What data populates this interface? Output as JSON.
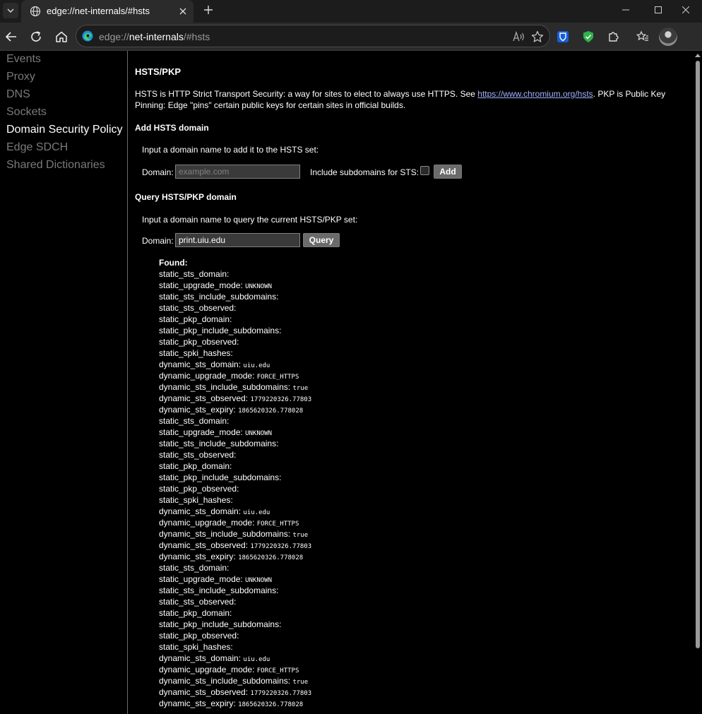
{
  "tab": {
    "title": "edge://net-internals/#hsts"
  },
  "omnibox": {
    "scheme": "edge://",
    "host": "net-internals",
    "path": "/#hsts"
  },
  "sidebar": {
    "items": [
      {
        "label": "Events",
        "active": false
      },
      {
        "label": "Proxy",
        "active": false
      },
      {
        "label": "DNS",
        "active": false
      },
      {
        "label": "Sockets",
        "active": false
      },
      {
        "label": "Domain Security Policy",
        "active": true
      },
      {
        "label": "Edge SDCH",
        "active": false
      },
      {
        "label": "Shared Dictionaries",
        "active": false
      }
    ]
  },
  "main": {
    "title": "HSTS/PKP",
    "intro_before": "HSTS is HTTP Strict Transport Security: a way for sites to elect to always use HTTPS. See ",
    "intro_link": "https://www.chromium.org/hsts",
    "intro_after": ". PKP is Public Key Pinning: Edge \"pins\" certain public keys for certain sites in official builds.",
    "add": {
      "heading": "Add HSTS domain",
      "description": "Input a domain name to add it to the HSTS set:",
      "domain_label": "Domain:",
      "domain_placeholder": "example.com",
      "subdomains_label": "Include subdomains for STS:",
      "button": "Add"
    },
    "query": {
      "heading": "Query HSTS/PKP domain",
      "description": "Input a domain name to query the current HSTS/PKP set:",
      "domain_label": "Domain:",
      "domain_value": "print.uiu.edu",
      "button": "Query"
    },
    "results": {
      "found_label": "Found:",
      "lines": [
        {
          "k": "static_sts_domain:",
          "v": ""
        },
        {
          "k": "static_upgrade_mode:",
          "v": "UNKNOWN"
        },
        {
          "k": "static_sts_include_subdomains:",
          "v": ""
        },
        {
          "k": "static_sts_observed:",
          "v": ""
        },
        {
          "k": "static_pkp_domain:",
          "v": ""
        },
        {
          "k": "static_pkp_include_subdomains:",
          "v": ""
        },
        {
          "k": "static_pkp_observed:",
          "v": ""
        },
        {
          "k": "static_spki_hashes:",
          "v": ""
        },
        {
          "k": "dynamic_sts_domain:",
          "v": "uiu.edu"
        },
        {
          "k": "dynamic_upgrade_mode:",
          "v": "FORCE_HTTPS"
        },
        {
          "k": "dynamic_sts_include_subdomains:",
          "v": "true"
        },
        {
          "k": "dynamic_sts_observed:",
          "v": "1779220326.77803"
        },
        {
          "k": "dynamic_sts_expiry:",
          "v": "1865620326.778028"
        },
        {
          "k": "static_sts_domain:",
          "v": ""
        },
        {
          "k": "static_upgrade_mode:",
          "v": "UNKNOWN"
        },
        {
          "k": "static_sts_include_subdomains:",
          "v": ""
        },
        {
          "k": "static_sts_observed:",
          "v": ""
        },
        {
          "k": "static_pkp_domain:",
          "v": ""
        },
        {
          "k": "static_pkp_include_subdomains:",
          "v": ""
        },
        {
          "k": "static_pkp_observed:",
          "v": ""
        },
        {
          "k": "static_spki_hashes:",
          "v": ""
        },
        {
          "k": "dynamic_sts_domain:",
          "v": "uiu.edu"
        },
        {
          "k": "dynamic_upgrade_mode:",
          "v": "FORCE_HTTPS"
        },
        {
          "k": "dynamic_sts_include_subdomains:",
          "v": "true"
        },
        {
          "k": "dynamic_sts_observed:",
          "v": "1779220326.77803"
        },
        {
          "k": "dynamic_sts_expiry:",
          "v": "1865620326.778028"
        },
        {
          "k": "static_sts_domain:",
          "v": ""
        },
        {
          "k": "static_upgrade_mode:",
          "v": "UNKNOWN"
        },
        {
          "k": "static_sts_include_subdomains:",
          "v": ""
        },
        {
          "k": "static_sts_observed:",
          "v": ""
        },
        {
          "k": "static_pkp_domain:",
          "v": ""
        },
        {
          "k": "static_pkp_include_subdomains:",
          "v": ""
        },
        {
          "k": "static_pkp_observed:",
          "v": ""
        },
        {
          "k": "static_spki_hashes:",
          "v": ""
        },
        {
          "k": "dynamic_sts_domain:",
          "v": "uiu.edu"
        },
        {
          "k": "dynamic_upgrade_mode:",
          "v": "FORCE_HTTPS"
        },
        {
          "k": "dynamic_sts_include_subdomains:",
          "v": "true"
        },
        {
          "k": "dynamic_sts_observed:",
          "v": "1779220326.77803"
        },
        {
          "k": "dynamic_sts_expiry:",
          "v": "1865620326.778028"
        }
      ]
    }
  },
  "colors": {
    "accent_link": "#9fb4ff",
    "bitwarden": "#175ddc",
    "shield": "#2fb34a"
  }
}
